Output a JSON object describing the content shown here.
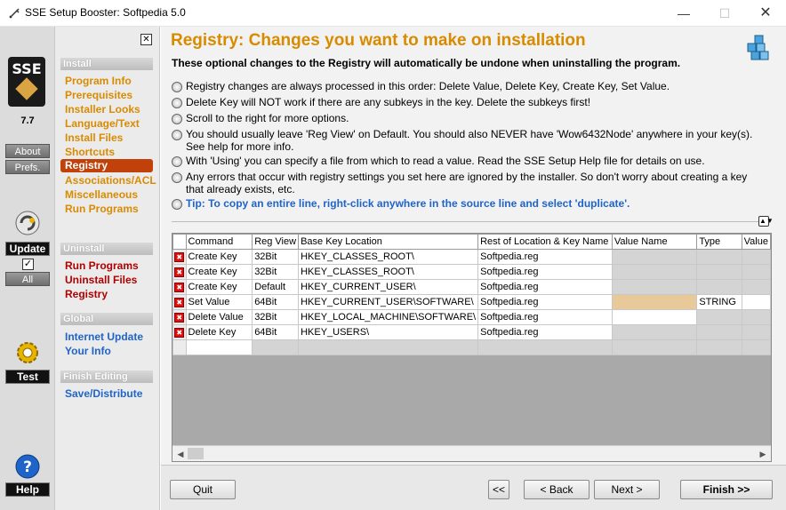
{
  "window": {
    "title": "SSE Setup Booster: Softpedia 5.0",
    "minimize_glyph": "—",
    "maximize_glyph": "☐",
    "close_glyph": "✕"
  },
  "left": {
    "logo_text": "SSE",
    "version": "7.7",
    "about_label": "About",
    "prefs_label": "Prefs.",
    "update_label": "Update",
    "update_checked": "✓",
    "all_label": "All",
    "test_label": "Test",
    "help_label": "Help"
  },
  "nav": {
    "close_glyph": "✕",
    "install_header": "Install",
    "install_items": [
      "Program Info",
      "Prerequisites",
      "Installer Looks",
      "Language/Text",
      "Install Files",
      "Shortcuts",
      "Registry",
      "Associations/ACL",
      "Miscellaneous",
      "Run Programs"
    ],
    "uninstall_header": "Uninstall",
    "uninstall_items": [
      "Run Programs",
      "Uninstall Files",
      "Registry"
    ],
    "global_header": "Global",
    "global_items": [
      "Internet Update",
      "Your Info"
    ],
    "finish_header": "Finish Editing",
    "finish_items": [
      "Save/Distribute"
    ]
  },
  "main": {
    "title": "Registry: Changes you want to make on installation",
    "subtitle": "These optional changes to the Registry will automatically be undone when uninstalling the program.",
    "bullets": [
      "Registry changes are always processed in this order: Delete Value, Delete Key, Create Key, Set Value.",
      "Delete Key will NOT work if there are any subkeys in the key. Delete the subkeys first!",
      "Scroll to the right for more options.",
      "You should usually leave 'Reg View' on Default. You should also NEVER have 'Wow6432Node' anywhere in your key(s). See help for more info.",
      "With 'Using' you can specify a file from which to read a value. Read the SSE Setup Help file for details on use.",
      "Any errors that occur with registry settings you set here are ignored by the installer. So don't worry about creating a key that already exists, etc."
    ],
    "tip": "Tip: To copy an entire line, right-click anywhere in the source line and select 'duplicate'."
  },
  "grid": {
    "columns": [
      "Command",
      "Reg View",
      "Base Key Location",
      "Rest of Location & Key Name",
      "Value Name",
      "Type",
      "Value"
    ],
    "rows": [
      [
        "Create Key",
        "32Bit",
        "HKEY_CLASSES_ROOT\\",
        "Softpedia.reg",
        "",
        "",
        ""
      ],
      [
        "Create Key",
        "32Bit",
        "HKEY_CLASSES_ROOT\\",
        "Softpedia.reg",
        "",
        "",
        ""
      ],
      [
        "Create Key",
        "Default",
        "HKEY_CURRENT_USER\\",
        "Softpedia.reg",
        "",
        "",
        ""
      ],
      [
        "Set Value",
        "64Bit",
        "HKEY_CURRENT_USER\\SOFTWARE\\",
        "Softpedia.reg",
        "",
        "STRING",
        ""
      ],
      [
        "Delete Value",
        "32Bit",
        "HKEY_LOCAL_MACHINE\\SOFTWARE\\",
        "Softpedia.reg",
        "",
        "",
        ""
      ],
      [
        "Delete Key",
        "64Bit",
        "HKEY_USERS\\",
        "Softpedia.reg",
        "",
        "",
        ""
      ]
    ]
  },
  "buttons": {
    "quit": "Quit",
    "first": "<<",
    "back": "< Back",
    "next": "Next >",
    "finish": "Finish >>"
  }
}
